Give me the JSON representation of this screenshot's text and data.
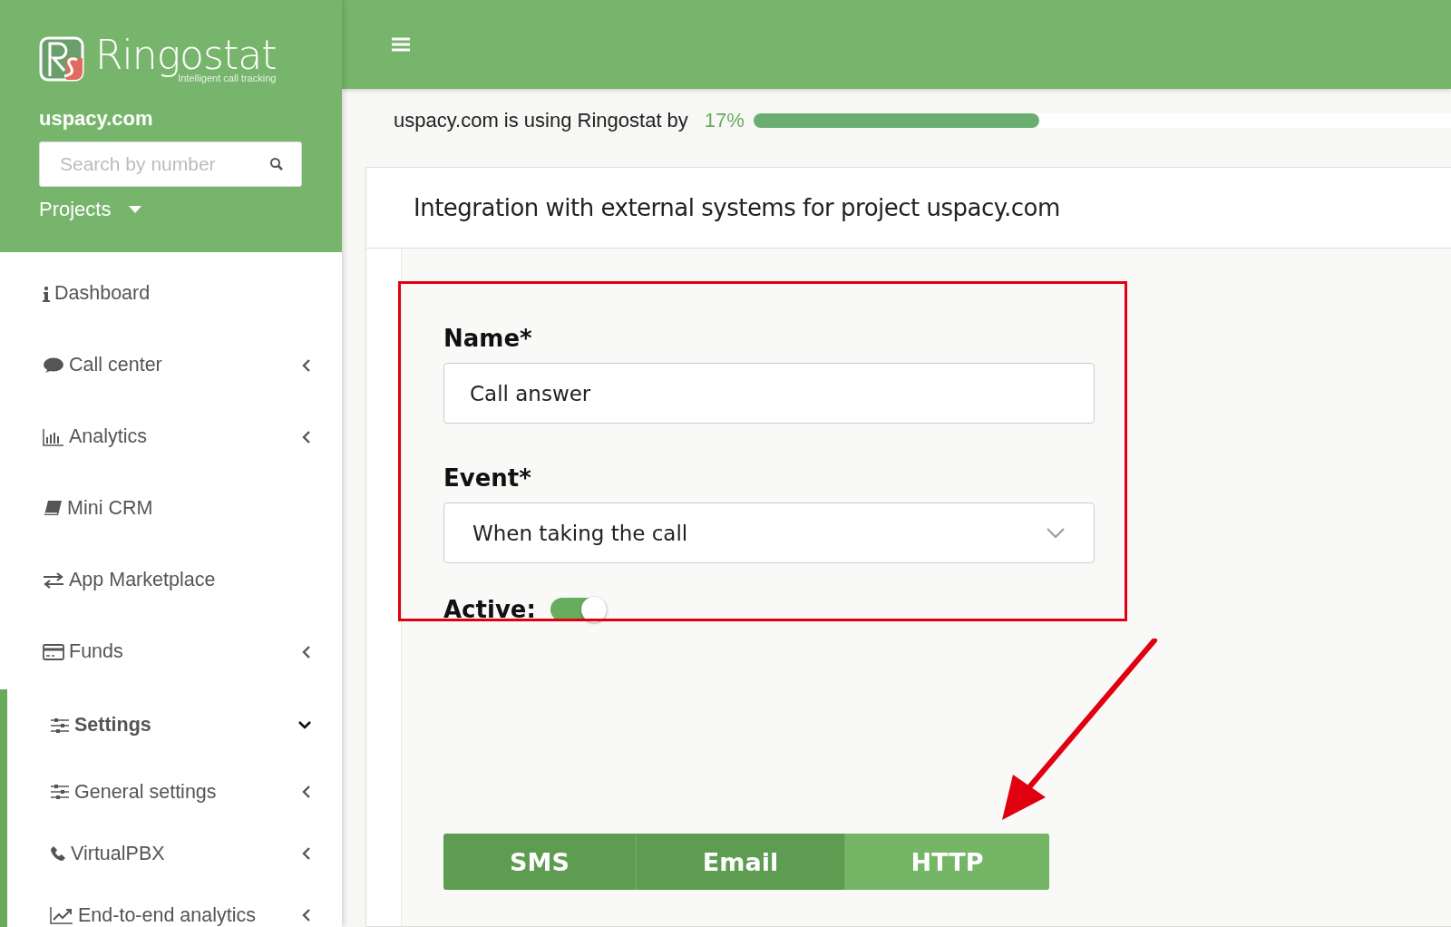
{
  "brand": {
    "name": "Ringostat",
    "tagline": "Intelligent call tracking"
  },
  "sidebar": {
    "project": "uspacy.com",
    "search": {
      "placeholder": "Search by number"
    },
    "projects_label": "Projects",
    "items": [
      {
        "label": "Dashboard"
      },
      {
        "label": "Call center",
        "expanded": false
      },
      {
        "label": "Analytics",
        "expanded": false
      },
      {
        "label": "Mini CRM"
      },
      {
        "label": "App Marketplace"
      },
      {
        "label": "Funds",
        "expanded": false
      },
      {
        "label": "Settings",
        "expanded": true,
        "children": [
          {
            "label": "General settings",
            "expanded": false
          },
          {
            "label": "VirtualPBX",
            "expanded": false
          },
          {
            "label": "End-to-end analytics",
            "expanded": false
          }
        ]
      }
    ]
  },
  "usage": {
    "text": "uspacy.com is using Ringostat by",
    "percent": "17%",
    "level": 0.41
  },
  "panel": {
    "title": "Integration with external systems for project uspacy.com",
    "name_label": "Name*",
    "name_value": "Call answer",
    "event_label": "Event*",
    "event_value": "When taking the call",
    "active_label": "Active:",
    "active": true,
    "tabs": [
      {
        "label": "SMS",
        "selected": false
      },
      {
        "label": "Email",
        "selected": false
      },
      {
        "label": "HTTP",
        "selected": true
      }
    ]
  }
}
